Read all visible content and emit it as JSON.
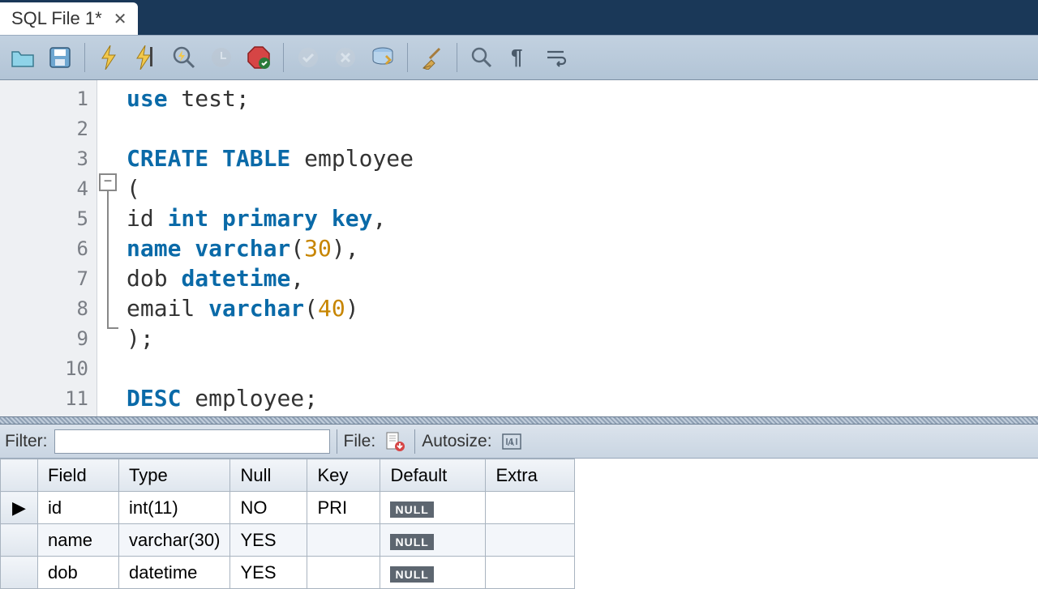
{
  "tab": {
    "title": "SQL File 1*"
  },
  "toolbar_icons": {
    "open": "open-icon",
    "save": "save-icon",
    "execute": "execute-icon",
    "execute_current": "execute-current-icon",
    "explain": "explain-icon",
    "stop": "stop-icon",
    "stop_hard": "stop-hard-icon",
    "commit": "commit-icon",
    "rollback": "rollback-icon",
    "autocommit": "autocommit-icon",
    "beautify": "beautify-icon",
    "find": "find-icon",
    "invisible": "invisible-icon",
    "wrap": "wrap-icon"
  },
  "editor": {
    "lines": [
      {
        "n": "1",
        "dot": true
      },
      {
        "n": "2",
        "dot": false
      },
      {
        "n": "3",
        "dot": true
      },
      {
        "n": "4",
        "dot": false
      },
      {
        "n": "5",
        "dot": false
      },
      {
        "n": "6",
        "dot": false
      },
      {
        "n": "7",
        "dot": false
      },
      {
        "n": "8",
        "dot": false
      },
      {
        "n": "9",
        "dot": false
      },
      {
        "n": "10",
        "dot": false
      },
      {
        "n": "11",
        "dot": true
      }
    ],
    "code": {
      "l1_kw": "use",
      "l1_rest": " test;",
      "l3_kw": "CREATE TABLE",
      "l3_rest": " employee",
      "l4": "(",
      "l5_a": "id ",
      "l5_kw": "int primary key",
      "l5_b": ",",
      "l6_kw": "name varchar",
      "l6_a": "(",
      "l6_num": "30",
      "l6_b": "),",
      "l7_a": "dob ",
      "l7_kw": "datetime",
      "l7_b": ",",
      "l8_a": "email ",
      "l8_kw": "varchar",
      "l8_b": "(",
      "l8_num": "40",
      "l8_c": ")",
      "l9": ");",
      "l11_kw": "DESC",
      "l11_rest": " employee;"
    }
  },
  "results": {
    "filter_label": "Filter:",
    "file_label": "File:",
    "autosize_label": "Autosize:",
    "columns": [
      "Field",
      "Type",
      "Null",
      "Key",
      "Default",
      "Extra"
    ],
    "rows": [
      {
        "field": "id",
        "type": "int(11)",
        "null": "NO",
        "key": "PRI",
        "default": "NULL",
        "extra": ""
      },
      {
        "field": "name",
        "type": "varchar(30)",
        "null": "YES",
        "key": "",
        "default": "NULL",
        "extra": ""
      },
      {
        "field": "dob",
        "type": "datetime",
        "null": "YES",
        "key": "",
        "default": "NULL",
        "extra": ""
      }
    ],
    "row_indicator": "▶"
  }
}
